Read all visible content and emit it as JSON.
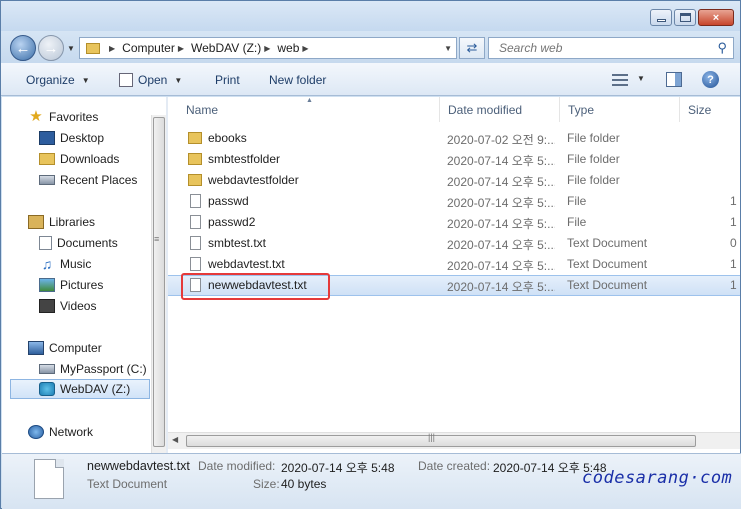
{
  "window": {
    "controls": {
      "minimize": "minimize",
      "maximize": "maximize",
      "close": "×"
    }
  },
  "nav": {
    "back_icon": "back-arrow-icon",
    "breadcrumb": [
      "Computer",
      "WebDAV (Z:)",
      "web"
    ],
    "search_placeholder": "Search web"
  },
  "toolbar": {
    "organize": "Organize",
    "open": "Open",
    "print": "Print",
    "new_folder": "New folder"
  },
  "sidebar": {
    "favorites": "Favorites",
    "desktop": "Desktop",
    "downloads": "Downloads",
    "recent": "Recent Places",
    "libraries": "Libraries",
    "documents": "Documents",
    "music": "Music",
    "pictures": "Pictures",
    "videos": "Videos",
    "computer": "Computer",
    "mypassport": "MyPassport (C:)",
    "webdav": "WebDAV (Z:)",
    "network": "Network"
  },
  "columns": {
    "name": "Name",
    "date": "Date modified",
    "type": "Type",
    "size": "Size"
  },
  "files": [
    {
      "name": "ebooks",
      "date": "2020-07-02 오전 9:...",
      "type": "File folder",
      "size": "",
      "icon": "folder"
    },
    {
      "name": "smbtestfolder",
      "date": "2020-07-14 오후 5:...",
      "type": "File folder",
      "size": "",
      "icon": "folder"
    },
    {
      "name": "webdavtestfolder",
      "date": "2020-07-14 오후 5:...",
      "type": "File folder",
      "size": "",
      "icon": "folder"
    },
    {
      "name": "passwd",
      "date": "2020-07-14 오후 5:...",
      "type": "File",
      "size": "1",
      "icon": "file"
    },
    {
      "name": "passwd2",
      "date": "2020-07-14 오후 5:...",
      "type": "File",
      "size": "1",
      "icon": "file"
    },
    {
      "name": "smbtest.txt",
      "date": "2020-07-14 오후 5:...",
      "type": "Text Document",
      "size": "0",
      "icon": "file"
    },
    {
      "name": "webdavtest.txt",
      "date": "2020-07-14 오후 5:...",
      "type": "Text Document",
      "size": "1",
      "icon": "file"
    },
    {
      "name": "newwebdavtest.txt",
      "date": "2020-07-14 오후 5:...",
      "type": "Text Document",
      "size": "1",
      "icon": "file"
    }
  ],
  "details": {
    "filename": "newwebdavtest.txt",
    "filetype": "Text Document",
    "modified_label": "Date modified:",
    "modified_value": "2020-07-14 오후 5:48",
    "created_label": "Date created:",
    "created_value": "2020-07-14 오후 5:48",
    "size_label": "Size:",
    "size_value": "40 bytes"
  },
  "watermark": "codesarang·com",
  "colors": {
    "selection_outline": "#e53a3a",
    "watermark": "#1a2fa8"
  }
}
